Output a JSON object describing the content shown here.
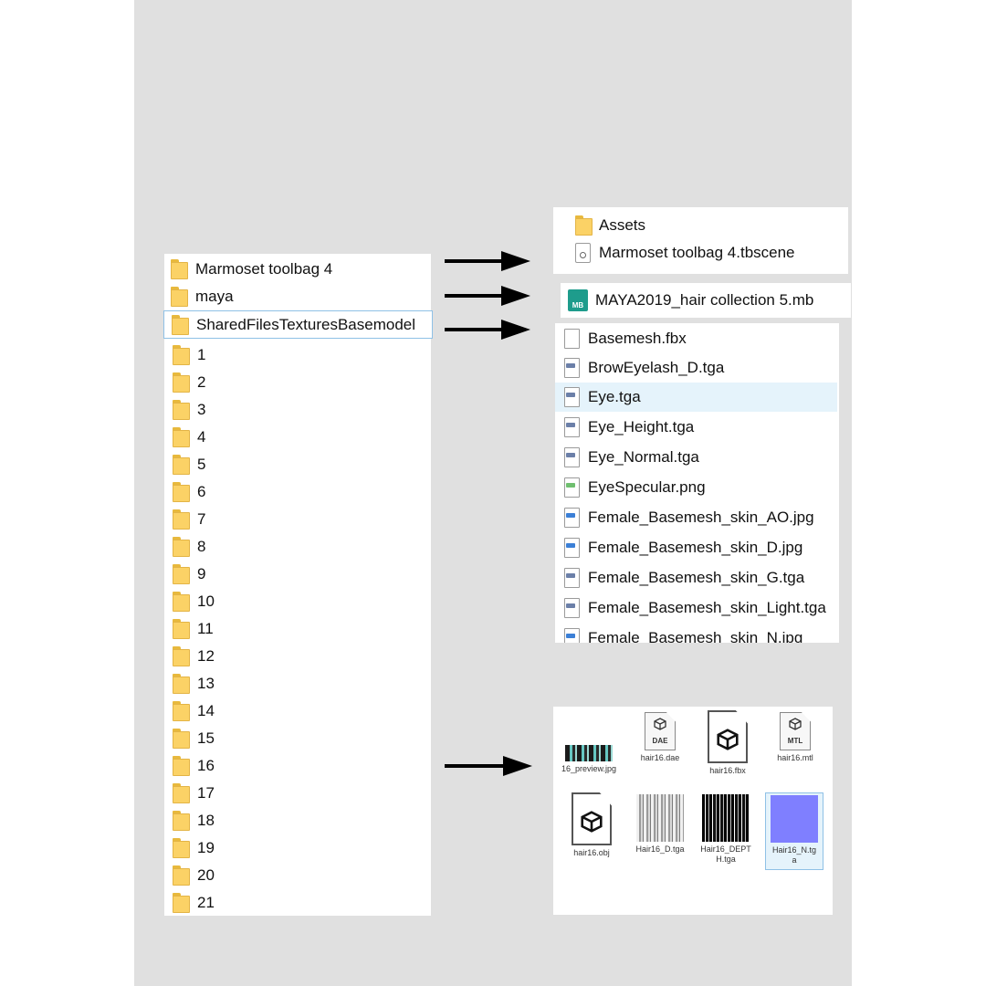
{
  "left_panel": {
    "items": [
      {
        "label": "Marmoset toolbag 4",
        "icon": "folder-icon"
      },
      {
        "label": "maya",
        "icon": "folder-icon"
      },
      {
        "label": "SharedFilesTexturesBasemodel",
        "icon": "folder-icon",
        "selected": true
      },
      {
        "label": "1"
      },
      {
        "label": "2"
      },
      {
        "label": "3"
      },
      {
        "label": "4"
      },
      {
        "label": "5"
      },
      {
        "label": "6"
      },
      {
        "label": "7"
      },
      {
        "label": "8"
      },
      {
        "label": "9"
      },
      {
        "label": "10"
      },
      {
        "label": "11"
      },
      {
        "label": "12"
      },
      {
        "label": "13"
      },
      {
        "label": "14"
      },
      {
        "label": "15"
      },
      {
        "label": "16"
      },
      {
        "label": "17"
      },
      {
        "label": "18"
      },
      {
        "label": "19"
      },
      {
        "label": "20"
      },
      {
        "label": "21"
      }
    ]
  },
  "marmoset_panel": {
    "items": [
      {
        "label": "Assets",
        "icon": "folder-icon"
      },
      {
        "label": "Marmoset toolbag 4.tbscene",
        "icon": "tbscene-file-icon"
      }
    ]
  },
  "maya_panel": {
    "items": [
      {
        "label": "MAYA2019_hair collection 5.mb",
        "icon": "maya-file-icon",
        "badge": "MB"
      }
    ]
  },
  "shared_panel": {
    "items": [
      {
        "label": "Basemesh.fbx",
        "icon": "fbx-file-icon"
      },
      {
        "label": "BrowEyelash_D.tga",
        "icon": "tga-file-icon"
      },
      {
        "label": "Eye.tga",
        "icon": "tga-file-icon",
        "selected": true
      },
      {
        "label": "Eye_Height.tga",
        "icon": "tga-file-icon"
      },
      {
        "label": "Eye_Normal.tga",
        "icon": "tga-file-icon"
      },
      {
        "label": "EyeSpecular.png",
        "icon": "png-file-icon"
      },
      {
        "label": "Female_Basemesh_skin_AO.jpg",
        "icon": "jpg-file-icon"
      },
      {
        "label": "Female_Basemesh_skin_D.jpg",
        "icon": "jpg-file-icon"
      },
      {
        "label": "Female_Basemesh_skin_G.tga",
        "icon": "tga-file-icon"
      },
      {
        "label": "Female_Basemesh_skin_Light.tga",
        "icon": "tga-file-icon"
      },
      {
        "label": "Female_Basemesh_skin_N.jpg",
        "icon": "jpg-file-icon"
      }
    ]
  },
  "thumbs_panel": {
    "items": [
      {
        "caption": "16_preview.jpg",
        "icon": "hair-preview-thumbnail"
      },
      {
        "caption": "hair16.dae",
        "icon": "dae-file-icon",
        "badge": "DAE"
      },
      {
        "caption": "hair16.fbx",
        "icon": "fbx-cube-icon"
      },
      {
        "caption": "hair16.mtl",
        "icon": "mtl-file-icon",
        "badge": "MTL"
      },
      {
        "caption": "hair16.obj",
        "icon": "obj-cube-icon"
      },
      {
        "caption": "Hair16_D.tga",
        "icon": "hair-diffuse-thumbnail"
      },
      {
        "caption": "Hair16_DEPTH.tga",
        "icon": "hair-depth-thumbnail"
      },
      {
        "caption": "Hair16_N.tga",
        "icon": "normal-map-thumbnail",
        "selected": true
      }
    ]
  },
  "colors": {
    "folder": "#fbd266",
    "selected_row": "#e5f3fb",
    "selected_border": "#8fc1e6",
    "normal_map": "#7f7fff",
    "maya_badge": "#1e9c8c",
    "png_tag": "#6fbf6f",
    "jpg_tag": "#3b7fd6",
    "tga_tag": "#6b7fa8"
  }
}
